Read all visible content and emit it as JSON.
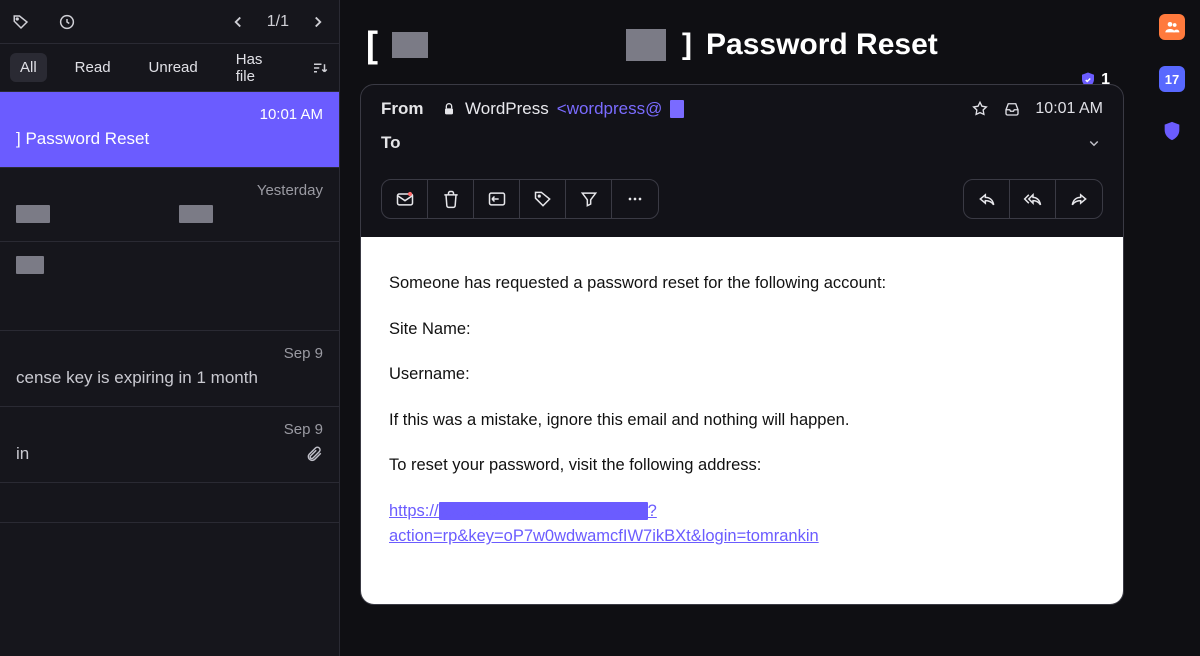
{
  "pager": {
    "count": "1/1"
  },
  "tabs": {
    "all": "All",
    "read": "Read",
    "unread": "Unread",
    "hasfile": "Has file"
  },
  "list": {
    "item0": {
      "time": "10:01 AM",
      "subject": "] Password Reset"
    },
    "item1": {
      "time": "Yesterday"
    },
    "item2": {
      "time": "Sep 9",
      "subject": "cense key is expiring in 1 month"
    },
    "item3": {
      "time": "Sep 9",
      "subject": "in"
    }
  },
  "reader": {
    "title": "Password Reset",
    "from_label": "From",
    "to_label": "To",
    "from_name": "WordPress",
    "from_addr": "<wordpress@",
    "time": "10:01 AM",
    "badge": "1"
  },
  "body": {
    "p1": "Someone has requested a password reset for the following account:",
    "p2": "Site Name:",
    "p3": "Username:",
    "p4": "If this was a mistake, ignore this email and nothing will happen.",
    "p5": "To reset your password, visit the following address:",
    "link_prefix": "https://",
    "link_q": "?",
    "link_rest": "action=rp&key=oP7w0wdwamcfIW7ikBXt&login=tomrankin"
  },
  "rail": {
    "cal": "17"
  }
}
